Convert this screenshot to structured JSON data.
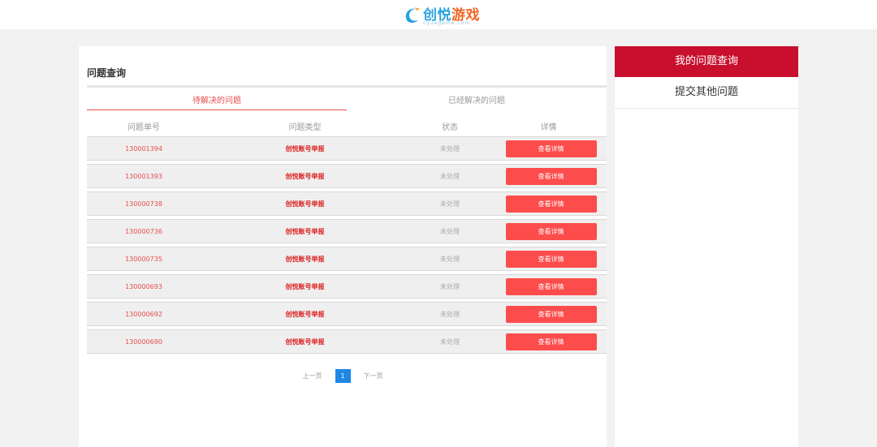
{
  "header": {
    "logo_text_part1": "创悦",
    "logo_text_part2": "游戏",
    "logo_subtext": "cyuegame.com"
  },
  "panel": {
    "title": "问题查询",
    "tabs": [
      {
        "label": "待解决的问题",
        "active": true
      },
      {
        "label": "已经解决的问题",
        "active": false
      }
    ],
    "columns": [
      "问题单号",
      "问题类型",
      "状态",
      "详情"
    ],
    "rows": [
      {
        "id": "130001394",
        "type": "创悦账号举报",
        "status": "未处理",
        "action": "查看详情"
      },
      {
        "id": "130001393",
        "type": "创悦账号举报",
        "status": "未处理",
        "action": "查看详情"
      },
      {
        "id": "130000738",
        "type": "创悦账号举报",
        "status": "未处理",
        "action": "查看详情"
      },
      {
        "id": "130000736",
        "type": "创悦账号举报",
        "status": "未处理",
        "action": "查看详情"
      },
      {
        "id": "130000735",
        "type": "创悦账号举报",
        "status": "未处理",
        "action": "查看详情"
      },
      {
        "id": "130000693",
        "type": "创悦账号举报",
        "status": "未处理",
        "action": "查看详情"
      },
      {
        "id": "130000692",
        "type": "创悦账号举报",
        "status": "未处理",
        "action": "查看详情"
      },
      {
        "id": "130000690",
        "type": "创悦账号举报",
        "status": "未处理",
        "action": "查看详情"
      }
    ],
    "pagination": {
      "prev": "上一页",
      "current": "1",
      "next": "下一页"
    }
  },
  "sidebar": {
    "items": [
      {
        "label": "我的问题查询",
        "active": true
      },
      {
        "label": "提交其他问题",
        "active": false
      }
    ]
  },
  "colors": {
    "accent_red": "#c8102e",
    "button_red": "#fd4c4c",
    "page_blue": "#1e88e5"
  }
}
